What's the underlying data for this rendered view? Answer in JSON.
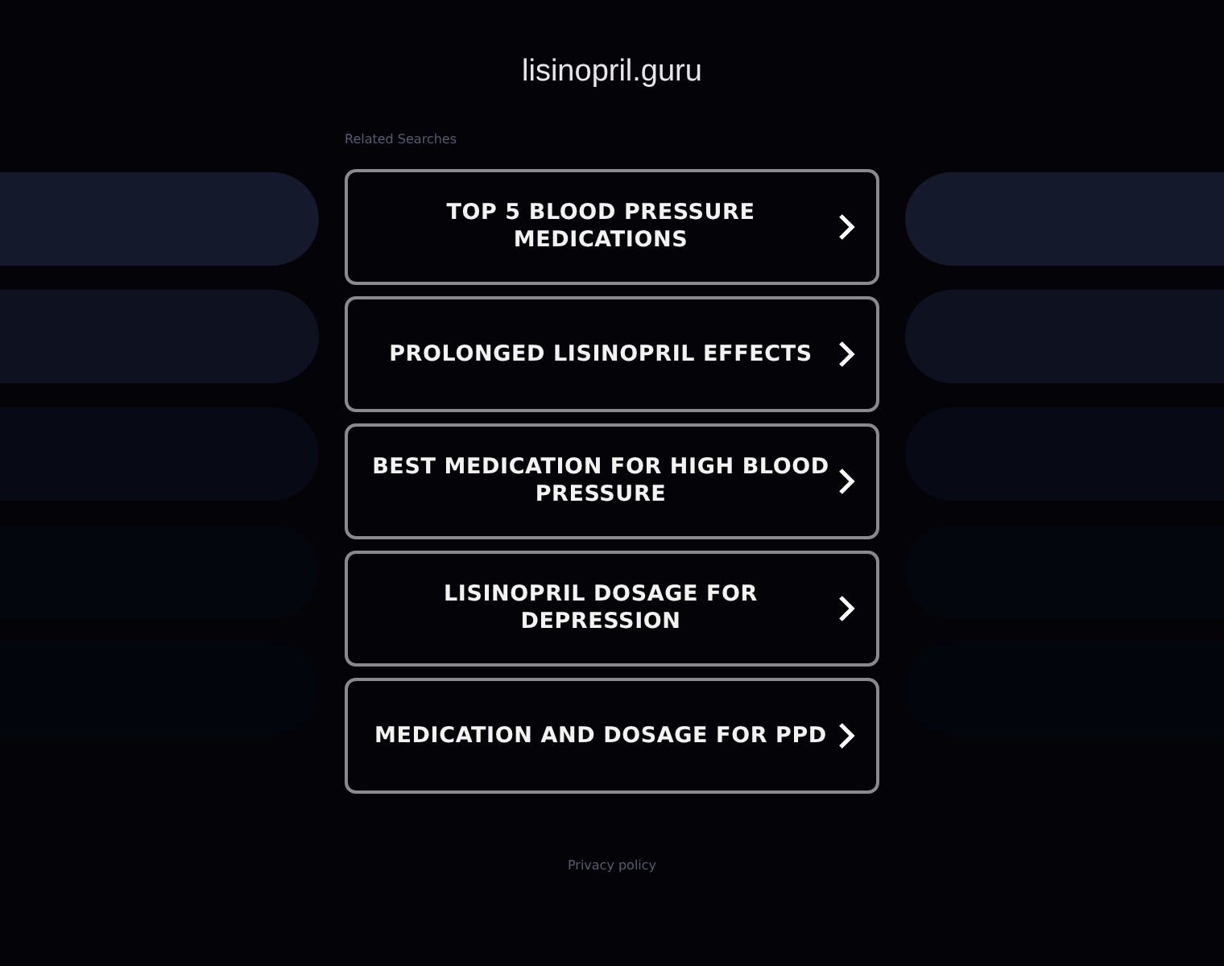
{
  "site_title": "lisinopril.guru",
  "related_label": "Related Searches",
  "links": [
    {
      "label": "TOP 5 BLOOD PRESSURE MEDICATIONS"
    },
    {
      "label": "PROLONGED LISINOPRIL EFFECTS"
    },
    {
      "label": "BEST MEDICATION FOR HIGH BLOOD PRESSURE"
    },
    {
      "label": "LISINOPRIL DOSAGE FOR DEPRESSION"
    },
    {
      "label": "MEDICATION AND DOSAGE FOR PPD"
    }
  ],
  "footer": {
    "privacy": "Privacy policy"
  }
}
